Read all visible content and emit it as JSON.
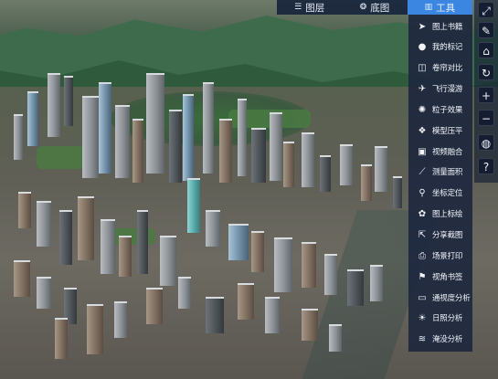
{
  "top_tabs": [
    {
      "label": "图层",
      "icon": "list-icon",
      "active": false
    },
    {
      "label": "底图",
      "icon": "globe-icon",
      "active": false
    },
    {
      "label": "工具",
      "icon": "chart-bar-icon",
      "active": true
    }
  ],
  "tools_menu": {
    "items": [
      {
        "label": "图上书籍",
        "icon": "send-arrow-icon"
      },
      {
        "label": "我的标记",
        "icon": "pin-icon"
      },
      {
        "label": "卷帘对比",
        "icon": "compare-icon"
      },
      {
        "label": "飞行漫游",
        "icon": "airplane-icon"
      },
      {
        "label": "粒子效果",
        "icon": "particle-icon"
      },
      {
        "label": "模型压平",
        "icon": "layers-icon"
      },
      {
        "label": "视频融合",
        "icon": "video-icon"
      },
      {
        "label": "测量面积",
        "icon": "ruler-icon"
      },
      {
        "label": "坐标定位",
        "icon": "location-icon"
      },
      {
        "label": "图上标绘",
        "icon": "draw-icon"
      },
      {
        "label": "分享截图",
        "icon": "share-icon"
      },
      {
        "label": "场景打印",
        "icon": "print-icon"
      },
      {
        "label": "视角书签",
        "icon": "bookmark-icon"
      },
      {
        "label": "通视度分析",
        "icon": "monitor-icon"
      },
      {
        "label": "日照分析",
        "icon": "sun-icon"
      },
      {
        "label": "淹没分析",
        "icon": "flood-icon"
      }
    ]
  },
  "right_toolbar": [
    {
      "name": "fullscreen-icon",
      "glyph": "⤢"
    },
    {
      "name": "measure-pencil-icon",
      "glyph": "✎"
    },
    {
      "name": "home-icon",
      "glyph": "⌂"
    },
    {
      "name": "refresh-icon",
      "glyph": "↻"
    },
    {
      "name": "zoom-in-icon",
      "glyph": "+"
    },
    {
      "name": "zoom-out-icon",
      "glyph": "−"
    },
    {
      "name": "globe-icon",
      "glyph": "◍"
    },
    {
      "name": "help-icon",
      "glyph": "?"
    }
  ],
  "colors": {
    "panel_bg": "#1e283e",
    "active_tab": "#3a86e0",
    "text": "#f2f5fa"
  }
}
